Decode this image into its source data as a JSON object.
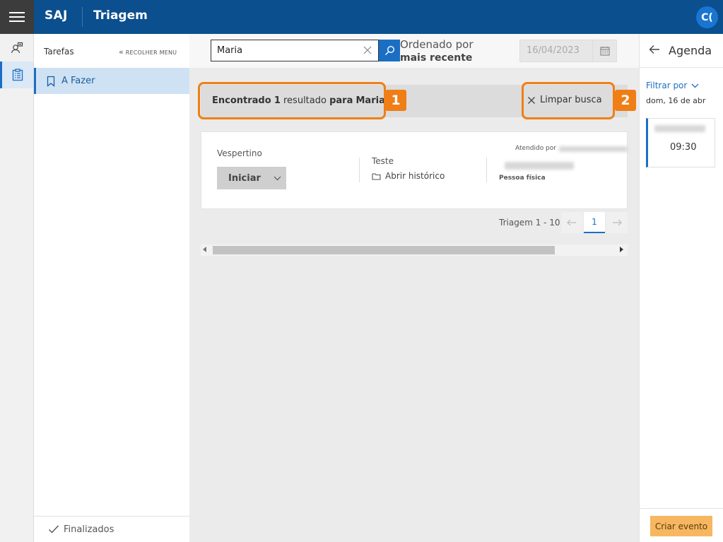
{
  "header": {
    "brand": "SAJ",
    "app_title": "Triagem",
    "avatar_initials": "C("
  },
  "rail": {
    "items": [
      {
        "icon": "user-transfer-icon"
      },
      {
        "icon": "clipboard-list-icon",
        "active": true
      }
    ]
  },
  "sidemenu": {
    "title": "Tarefas",
    "collapse_label": "RECOLHER MENU",
    "items": [
      {
        "label": "A Fazer",
        "icon": "bookmark-icon",
        "active": true
      }
    ],
    "footer": {
      "label": "Finalizados",
      "icon": "check-icon"
    }
  },
  "search": {
    "value": "Maria",
    "sort_label": "Ordenado por",
    "sort_value": "mais recente",
    "date": "16/04/2023"
  },
  "result": {
    "prefix": "Encontrado",
    "count": "1",
    "middle": "resultado",
    "for_word": "para",
    "term": "Maria",
    "clear_label": "Limpar busca"
  },
  "callouts": [
    "1",
    "2"
  ],
  "card": {
    "period": "Vespertino",
    "start_label": "Iniciar",
    "test_label": "Teste",
    "history_label": "Abrir histórico",
    "attended_label": "Atendido por",
    "person_type": "Pessoa física"
  },
  "pager": {
    "label": "Triagem 1 - 10",
    "current": "1"
  },
  "agenda": {
    "title": "Agenda",
    "filter_label": "Filtrar por",
    "date_label": "dom, 16 de abr",
    "event_time": "09:30",
    "create_label": "Criar evento"
  },
  "colors": {
    "header_bg": "#0b4f8e",
    "accent": "#1a6fc4",
    "callout": "#f07e16",
    "create_button": "#f7b760"
  }
}
